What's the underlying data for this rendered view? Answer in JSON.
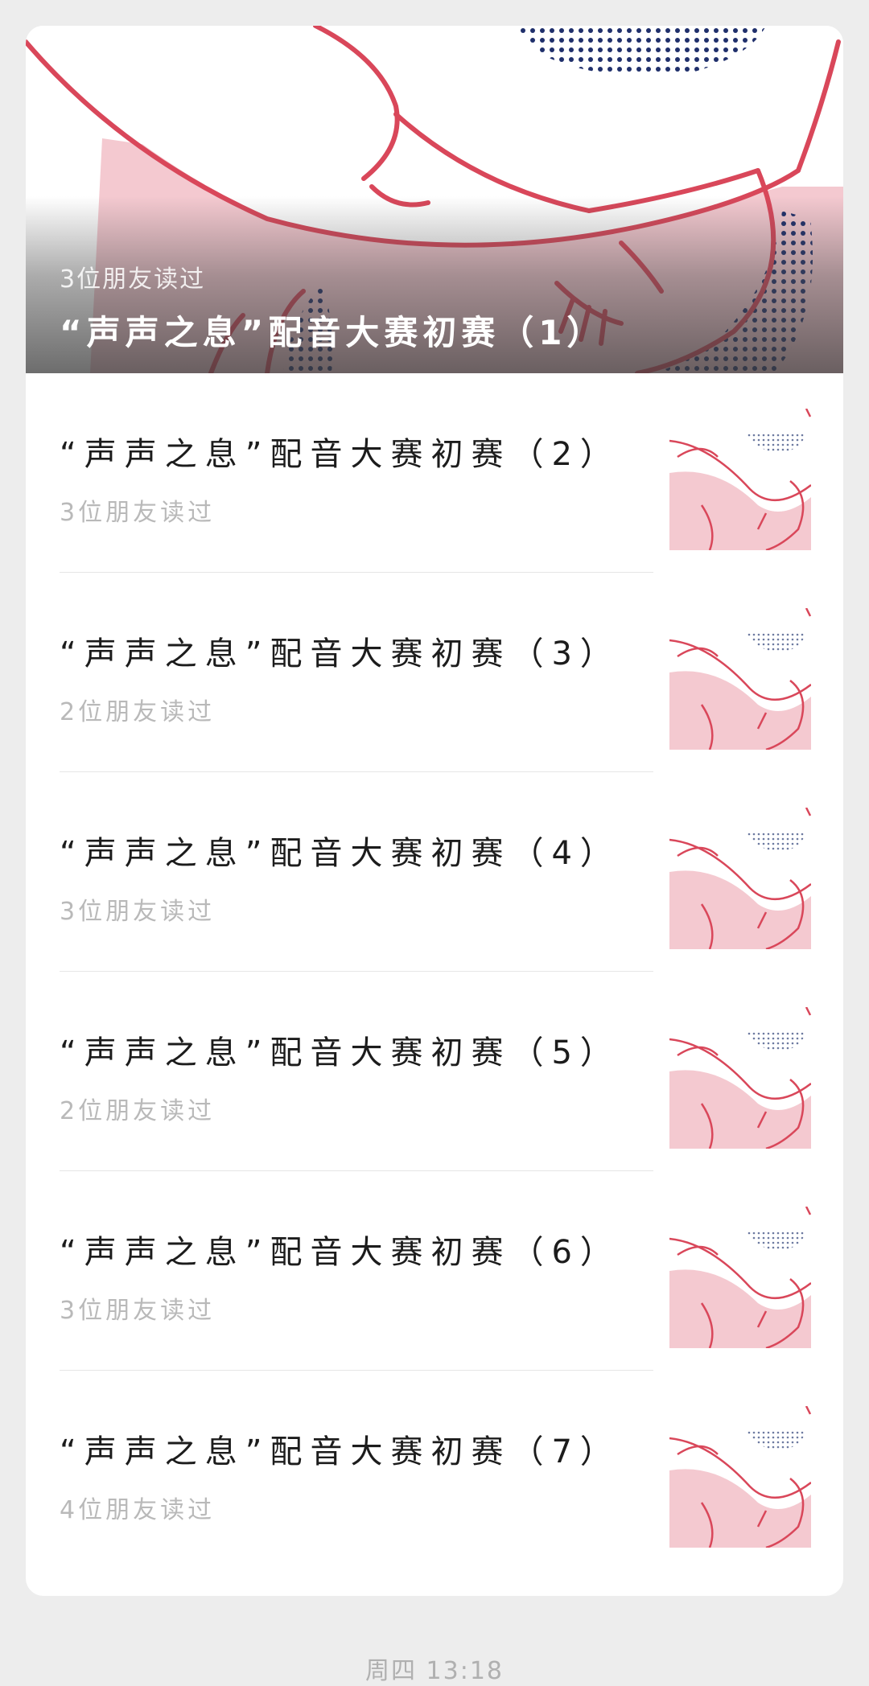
{
  "hero": {
    "readers": "3位朋友读过",
    "title": "“声声之息”配音大赛初赛（1）"
  },
  "items": [
    {
      "title": "“声声之息”配音大赛初赛（2）",
      "readers": "3位朋友读过"
    },
    {
      "title": "“声声之息”配音大赛初赛（3）",
      "readers": "2位朋友读过"
    },
    {
      "title": "“声声之息”配音大赛初赛（4）",
      "readers": "3位朋友读过"
    },
    {
      "title": "“声声之息”配音大赛初赛（5）",
      "readers": "2位朋友读过"
    },
    {
      "title": "“声声之息”配音大赛初赛（6）",
      "readers": "3位朋友读过"
    },
    {
      "title": "“声声之息”配音大赛初赛（7）",
      "readers": "4位朋友读过"
    }
  ],
  "footer": {
    "time": "周四 13:18"
  },
  "colors": {
    "line_red": "#d9475a",
    "skin_pink": "#f4c9d0",
    "dot_navy": "#1f2f6b"
  }
}
